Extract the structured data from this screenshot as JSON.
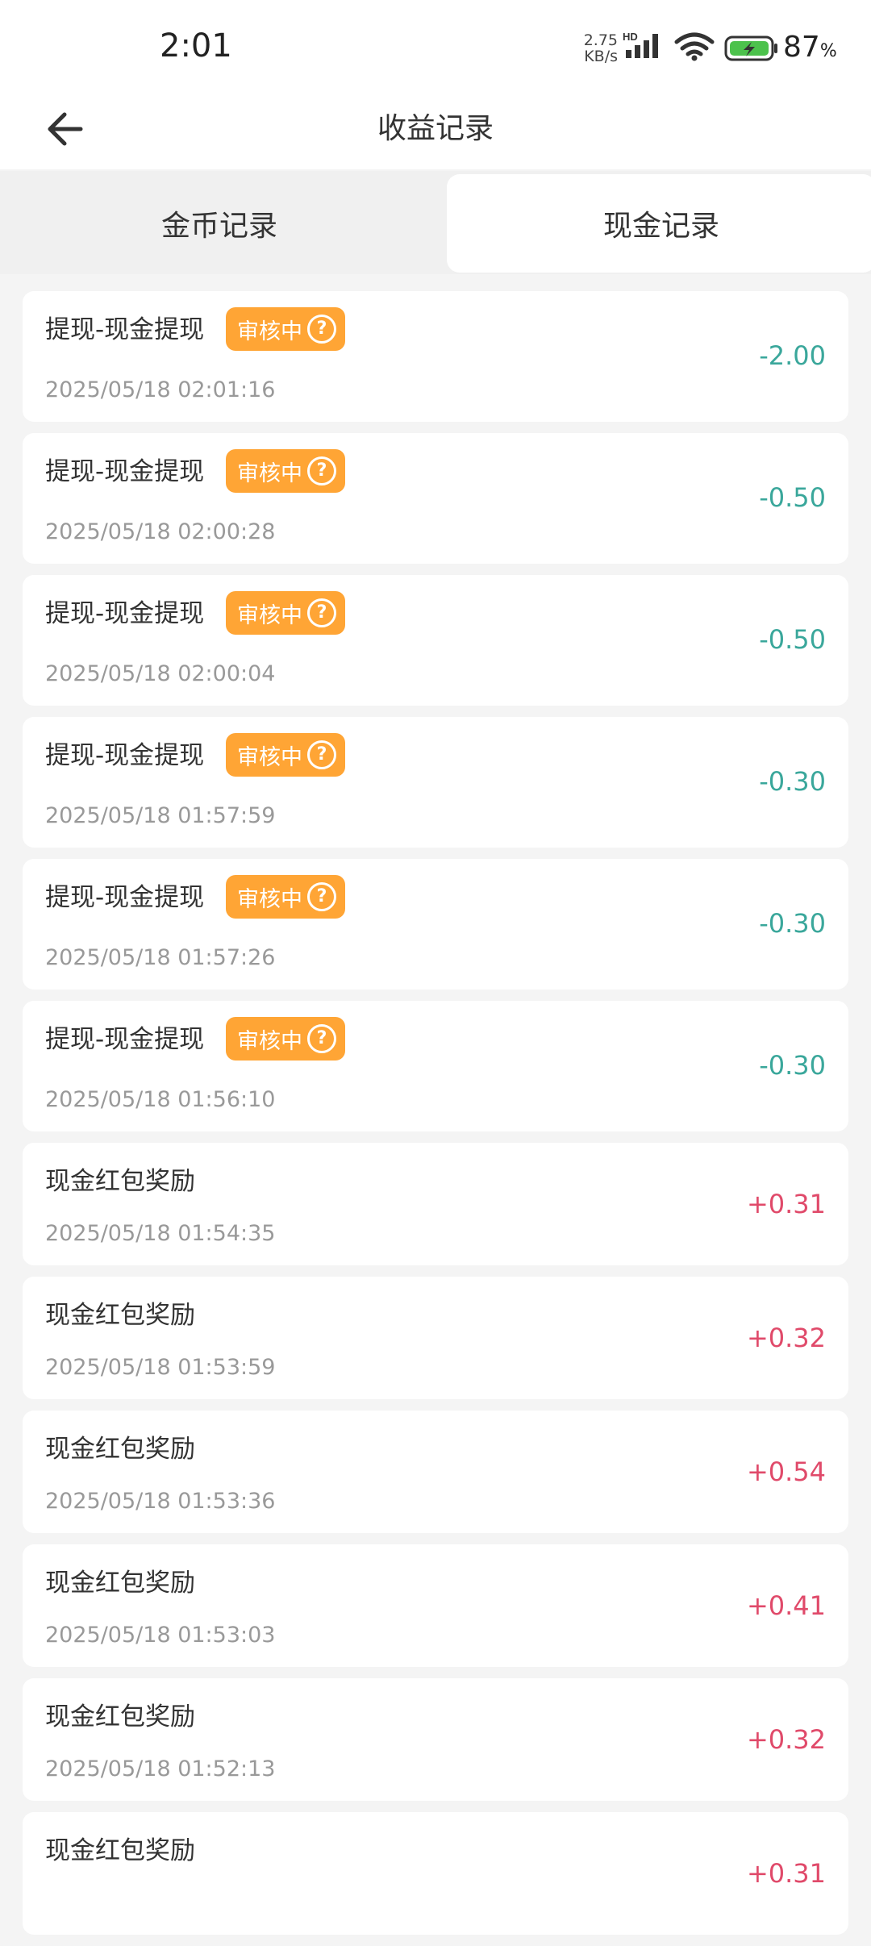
{
  "status_bar": {
    "time": "2:01",
    "net_speed_value": "2.75",
    "net_speed_unit": "KB/s",
    "battery_percent": "87",
    "battery_unit": "%"
  },
  "header": {
    "title": "收益记录"
  },
  "tabs": [
    {
      "label": "金币记录",
      "selected": false
    },
    {
      "label": "现金记录",
      "selected": true
    }
  ],
  "badge_label": "审核中",
  "colors": {
    "negative": "#3aa79b",
    "positive": "#e04a6a",
    "badge": "#ffa535"
  },
  "records": [
    {
      "title": "提现-现金提现",
      "time": "2025/05/18 02:01:16",
      "amount": "-2.00",
      "status": "审核中"
    },
    {
      "title": "提现-现金提现",
      "time": "2025/05/18 02:00:28",
      "amount": "-0.50",
      "status": "审核中"
    },
    {
      "title": "提现-现金提现",
      "time": "2025/05/18 02:00:04",
      "amount": "-0.50",
      "status": "审核中"
    },
    {
      "title": "提现-现金提现",
      "time": "2025/05/18 01:57:59",
      "amount": "-0.30",
      "status": "审核中"
    },
    {
      "title": "提现-现金提现",
      "time": "2025/05/18 01:57:26",
      "amount": "-0.30",
      "status": "审核中"
    },
    {
      "title": "提现-现金提现",
      "time": "2025/05/18 01:56:10",
      "amount": "-0.30",
      "status": "审核中"
    },
    {
      "title": "现金红包奖励",
      "time": "2025/05/18 01:54:35",
      "amount": "+0.31",
      "status": ""
    },
    {
      "title": "现金红包奖励",
      "time": "2025/05/18 01:53:59",
      "amount": "+0.32",
      "status": ""
    },
    {
      "title": "现金红包奖励",
      "time": "2025/05/18 01:53:36",
      "amount": "+0.54",
      "status": ""
    },
    {
      "title": "现金红包奖励",
      "time": "2025/05/18 01:53:03",
      "amount": "+0.41",
      "status": ""
    },
    {
      "title": "现金红包奖励",
      "time": "2025/05/18 01:52:13",
      "amount": "+0.32",
      "status": ""
    },
    {
      "title": "现金红包奖励",
      "time": "",
      "amount": "+0.31",
      "status": ""
    }
  ]
}
